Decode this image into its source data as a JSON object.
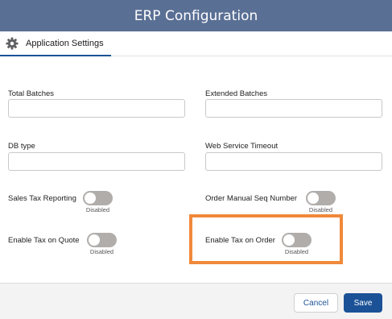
{
  "header": {
    "title": "ERP Configuration"
  },
  "tabs": [
    {
      "label": "Application Settings",
      "icon": "gear-icon"
    }
  ],
  "fields": {
    "total_batches": {
      "label": "Total Batches",
      "value": ""
    },
    "extended_batches": {
      "label": "Extended Batches",
      "value": ""
    },
    "db_type": {
      "label": "DB type",
      "value": ""
    },
    "web_service_timeout": {
      "label": "Web Service Timeout",
      "value": ""
    }
  },
  "toggles": {
    "sales_tax_reporting": {
      "label": "Sales Tax Reporting",
      "status": "Disabled"
    },
    "order_manual_seq_number": {
      "label": "Order Manual Seq Number",
      "status": "Disabled"
    },
    "enable_tax_on_quote": {
      "label": "Enable Tax on Quote",
      "status": "Disabled"
    },
    "enable_tax_on_order": {
      "label": "Enable Tax on Order",
      "status": "Disabled"
    }
  },
  "footer": {
    "cancel_label": "Cancel",
    "save_label": "Save"
  },
  "colors": {
    "header": "#5a6f94",
    "accent": "#1b5297",
    "highlight": "#f0893a",
    "toggle_off": "#b0adab"
  }
}
